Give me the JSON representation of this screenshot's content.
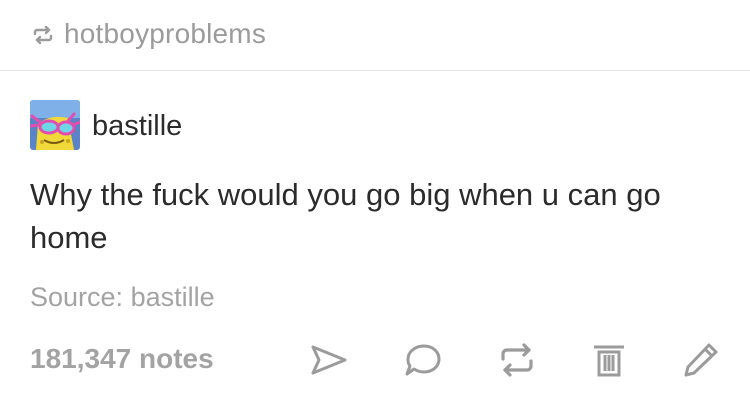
{
  "reblog": {
    "icon": "reblog-icon",
    "username": "hotboyproblems"
  },
  "post": {
    "avatar": "avatar",
    "username": "bastille",
    "text": "Why the fuck would you go big when u can go home",
    "source_label": "Source:",
    "source_value": "bastille"
  },
  "footer": {
    "notes": "181,347 notes",
    "actions": [
      "share-icon",
      "reply-icon",
      "reblog-icon",
      "delete-icon",
      "edit-icon"
    ],
    "icon_color": "#9b9b9b"
  }
}
